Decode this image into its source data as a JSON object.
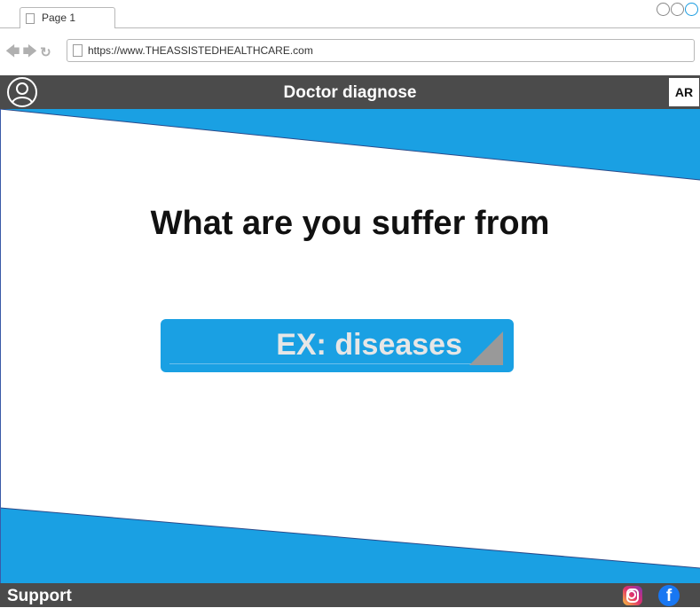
{
  "browser": {
    "tab_label": "Page 1",
    "url": "https://www.THEASSISTEDHEALTHCARE.com"
  },
  "appbar": {
    "title": "Doctor diagnose",
    "language_button": "AR"
  },
  "main": {
    "heading": "What are you suffer from",
    "disease_selector_value": "EX: diseases"
  },
  "footer": {
    "support_label": "Support"
  },
  "icons": {
    "avatar": "user-avatar-icon",
    "instagram": "instagram-icon",
    "facebook": "facebook-icon"
  },
  "colors": {
    "accent": "#1a9ce0",
    "bar": "#4b4b4b"
  }
}
